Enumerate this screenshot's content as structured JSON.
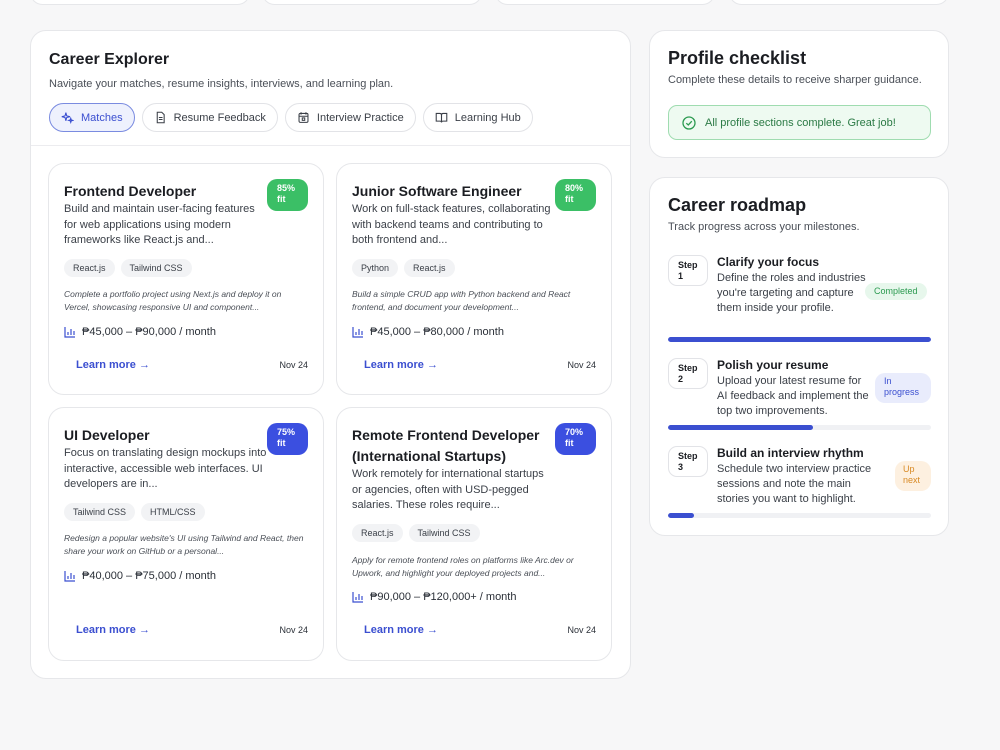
{
  "explorer": {
    "title": "Career Explorer",
    "subtitle": "Navigate your matches, resume insights, interviews, and learning plan.",
    "tabs": [
      {
        "label": "Matches",
        "icon": "sparkles-icon",
        "active": true
      },
      {
        "label": "Resume Feedback",
        "icon": "document-icon",
        "active": false
      },
      {
        "label": "Interview Practice",
        "icon": "calendar-icon",
        "active": false
      },
      {
        "label": "Learning Hub",
        "icon": "book-icon",
        "active": false
      }
    ]
  },
  "jobs": [
    {
      "title": "Frontend Developer",
      "fit": "85%",
      "fit_suffix": "fit",
      "fit_color": "#3bbf66",
      "description": "Build and maintain user-facing features for web applications using modern frameworks like React.js and...",
      "tags": [
        "React.js",
        "Tailwind CSS"
      ],
      "note": "Complete a portfolio project using Next.js and deploy it on Vercel, showcasing responsive UI and component...",
      "salary": "₱45,000 – ₱90,000 / month",
      "learn_more": "Learn more",
      "date": "Nov 24"
    },
    {
      "title": "Junior Software Engineer",
      "fit": "80%",
      "fit_suffix": "fit",
      "fit_color": "#3bbf66",
      "description": "Work on full-stack features, collaborating with backend teams and contributing to both frontend and...",
      "tags": [
        "Python",
        "React.js"
      ],
      "note": "Build a simple CRUD app with Python backend and React frontend, and document your development...",
      "salary": "₱45,000 – ₱80,000 / month",
      "learn_more": "Learn more",
      "date": "Nov 24"
    },
    {
      "title": "UI Developer",
      "fit": "75%",
      "fit_suffix": "fit",
      "fit_color": "#3b4fe0",
      "description": "Focus on translating design mockups into interactive, accessible web interfaces. UI developers are in...",
      "tags": [
        "Tailwind CSS",
        "HTML/CSS"
      ],
      "note": "Redesign a popular website's UI using Tailwind and React, then share your work on GitHub or a personal...",
      "salary": "₱40,000 – ₱75,000 / month",
      "learn_more": "Learn more",
      "date": "Nov 24"
    },
    {
      "title": "Remote Frontend Developer (International Startups)",
      "fit": "70%",
      "fit_suffix": "fit",
      "fit_color": "#3b4fe0",
      "description": "Work remotely for international startups or agencies, often with USD-pegged salaries. These roles require...",
      "tags": [
        "React.js",
        "Tailwind CSS"
      ],
      "note": "Apply for remote frontend roles on platforms like Arc.dev or Upwork, and highlight your deployed projects and...",
      "salary": "₱90,000 – ₱120,000+ / month",
      "learn_more": "Learn more",
      "date": "Nov 24"
    }
  ],
  "checklist": {
    "title": "Profile checklist",
    "subtitle": "Complete these details to receive sharper guidance.",
    "status": "All profile sections complete. Great job!"
  },
  "roadmap": {
    "title": "Career roadmap",
    "subtitle": "Track progress across your milestones.",
    "steps": [
      {
        "badge_word": "Step",
        "badge_num": "1",
        "title": "Clarify your focus",
        "description": "Define the roles and industries you're targeting and capture them inside your profile.",
        "status": "Completed",
        "progress": 1.0
      },
      {
        "badge_word": "Step",
        "badge_num": "2",
        "title": "Polish your resume",
        "description": "Upload your latest resume for AI feedback and implement the top two improvements.",
        "status": "In progress",
        "progress": 0.55
      },
      {
        "badge_word": "Step",
        "badge_num": "3",
        "title": "Build an interview rhythm",
        "description": "Schedule two interview practice sessions and note the main stories you want to highlight.",
        "status": "Up next",
        "progress": 0.1
      }
    ]
  },
  "colors": {
    "accent": "#3b4fd0",
    "success": "#3bbf66",
    "warning": "#d88a25"
  }
}
